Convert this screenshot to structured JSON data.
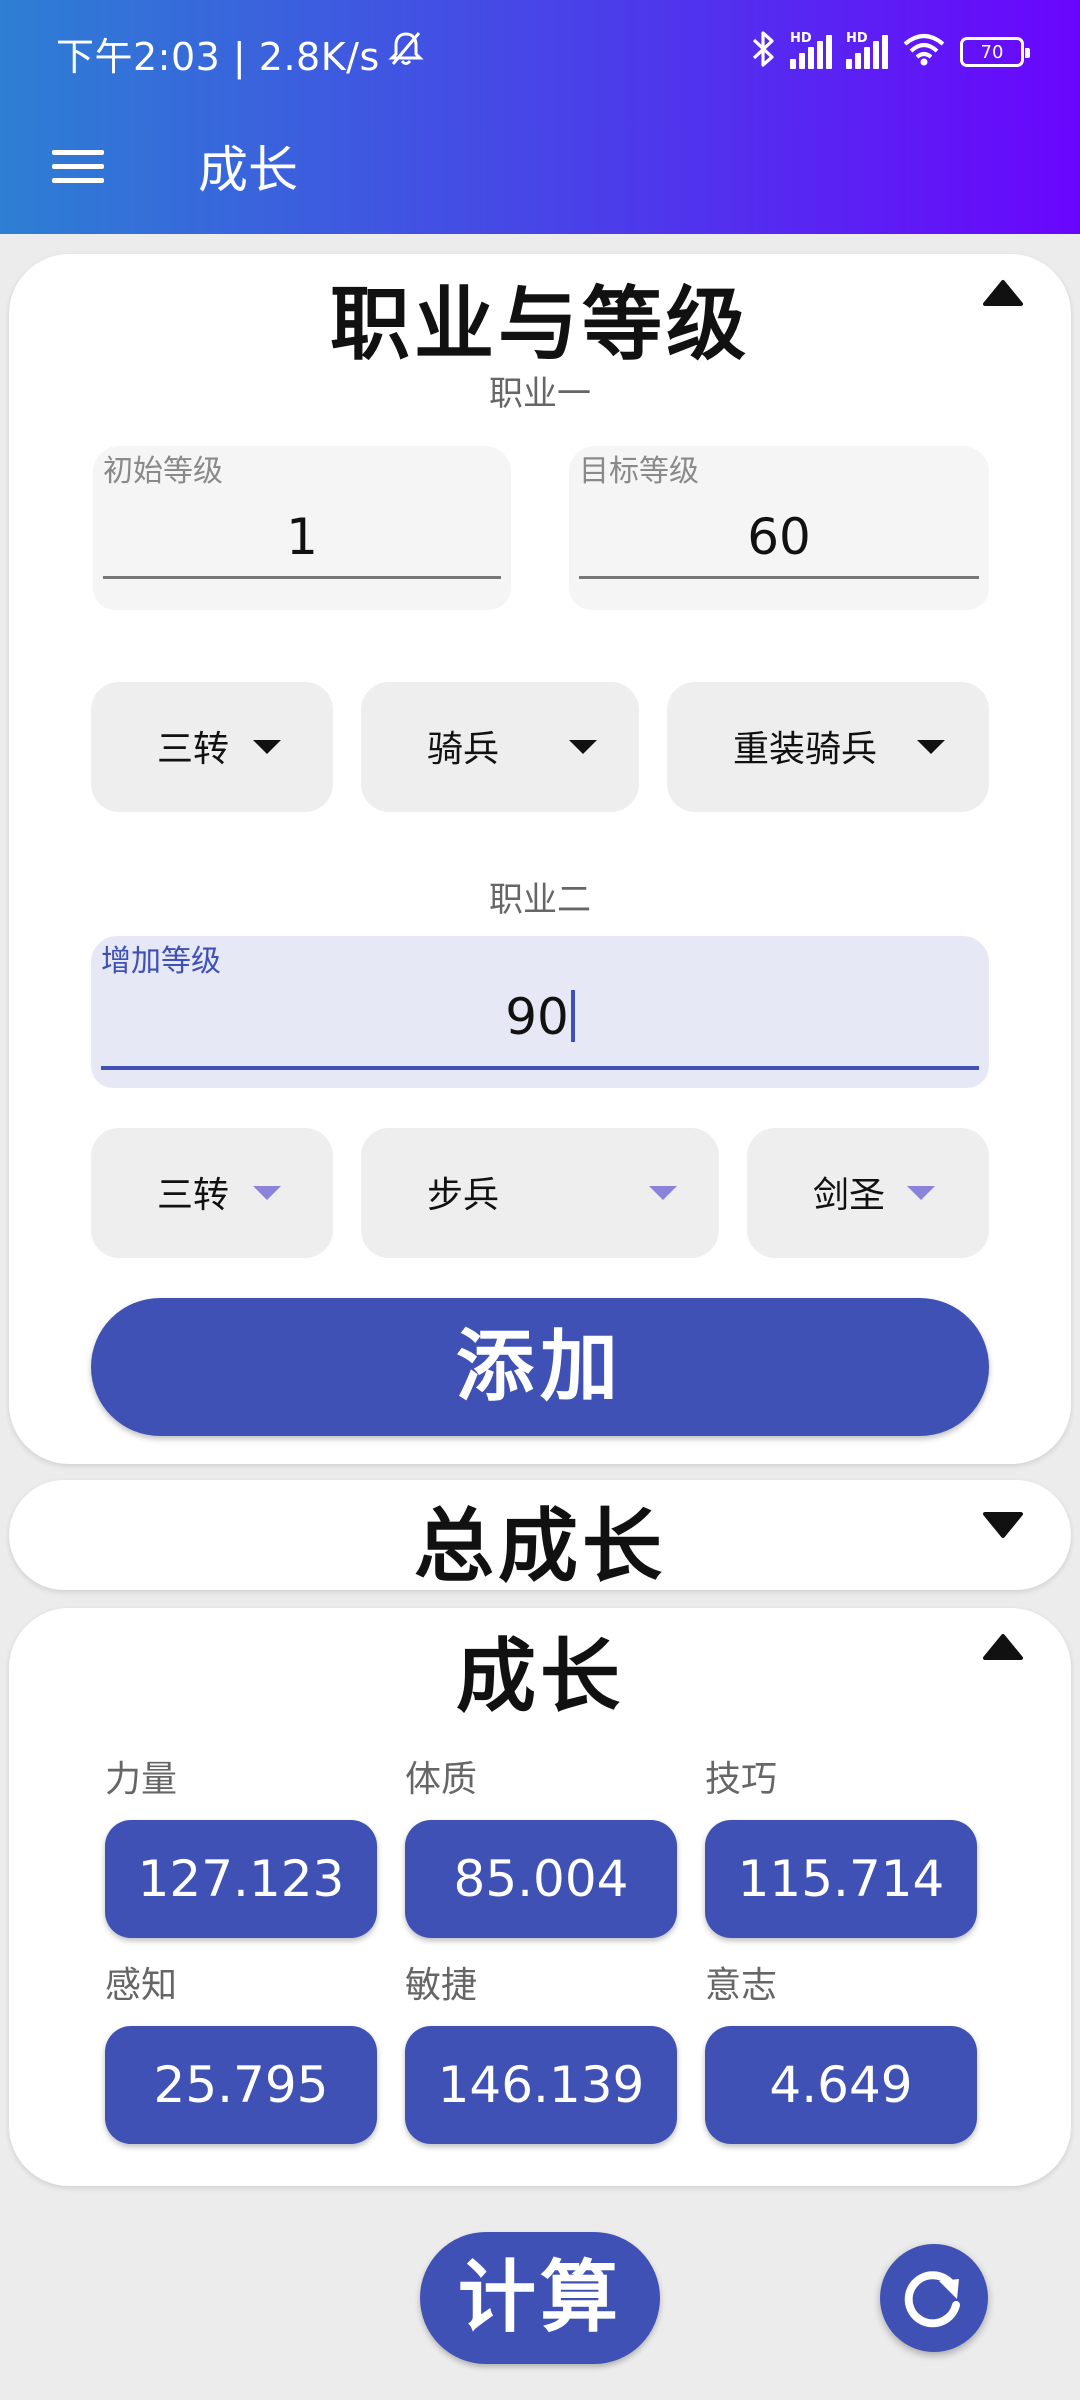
{
  "status_bar": {
    "time_speed": "下午2:03 | 2.8K/s",
    "battery": "70",
    "hd1": "HD",
    "hd2": "HD"
  },
  "app_bar": {
    "menu_icon": "menu-icon",
    "title": "成长"
  },
  "profession_card": {
    "title": "职业与等级",
    "collapse_icon": "collapse-up-icon",
    "job1_label": "职业一",
    "start_level": {
      "label": "初始等级",
      "value": "1"
    },
    "target_level": {
      "label": "目标等级",
      "value": "60"
    },
    "job1_dropdowns": [
      "三转",
      "骑兵",
      "重装骑兵"
    ],
    "job2_label": "职业二",
    "add_level": {
      "label": "增加等级",
      "value": "90"
    },
    "job2_dropdowns": [
      "三转",
      "步兵",
      "剑圣"
    ],
    "add_button": "添加"
  },
  "total_growth_card": {
    "title": "总成长",
    "expand_icon": "expand-down-icon"
  },
  "growth_card": {
    "title": "成长",
    "collapse_icon": "collapse-up-icon",
    "stats": [
      {
        "label": "力量",
        "value": "127.123"
      },
      {
        "label": "体质",
        "value": "85.004"
      },
      {
        "label": "技巧",
        "value": "115.714"
      },
      {
        "label": "感知",
        "value": "25.795"
      },
      {
        "label": "敏捷",
        "value": "146.139"
      },
      {
        "label": "意志",
        "value": "4.649"
      }
    ]
  },
  "actions": {
    "calculate": "计算",
    "refresh_icon": "refresh-icon"
  },
  "colors": {
    "primary": "#3f51b5",
    "header_start": "#2d7fd3",
    "header_end": "#6a05fd",
    "accent_arrow": "#8b82db"
  }
}
